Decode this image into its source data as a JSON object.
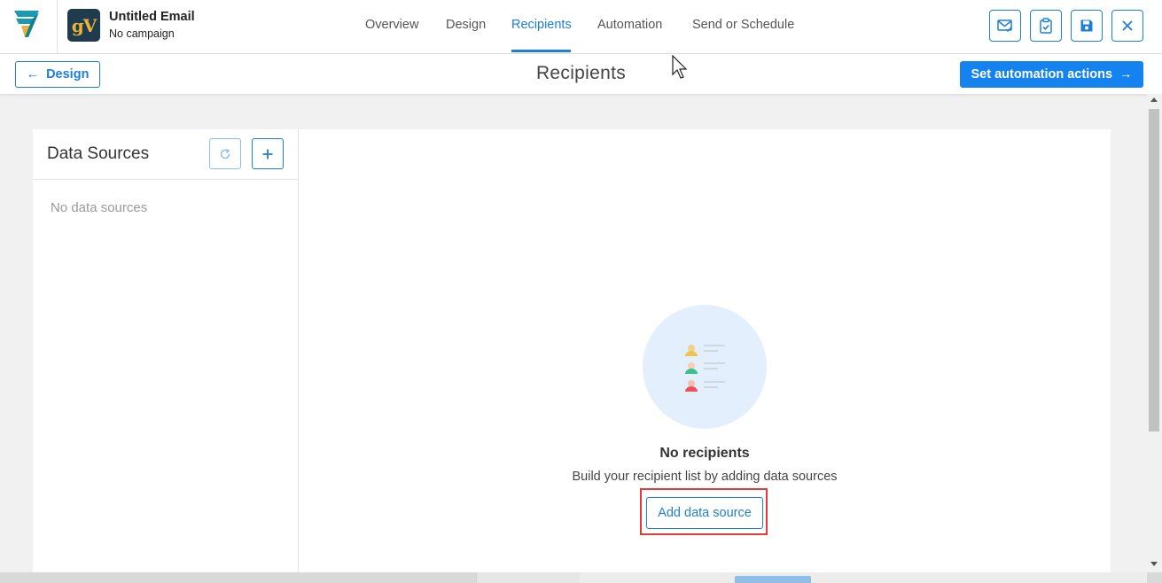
{
  "app": {
    "email_title": "Untitled Email",
    "campaign": "No campaign",
    "avatar_text": "gV"
  },
  "nav": {
    "items": [
      {
        "label": "Overview",
        "active": false
      },
      {
        "label": "Design",
        "active": false
      },
      {
        "label": "Recipients",
        "active": true
      },
      {
        "label": "Automation",
        "active": false
      },
      {
        "label": "Send or Schedule",
        "active": false
      }
    ]
  },
  "toolbar": {
    "icons": [
      "mail-check-icon",
      "clipboard-check-icon",
      "save-icon",
      "close-icon"
    ]
  },
  "subheader": {
    "back_label": "Design",
    "page_title": "Recipients",
    "next_label": "Set automation actions"
  },
  "data_sources": {
    "title": "Data Sources",
    "empty_text": "No data sources"
  },
  "recipients": {
    "empty_title": "No recipients",
    "empty_subtitle": "Build your recipient list by adding data sources",
    "add_label": "Add data source"
  },
  "colors": {
    "accent": "#1e7fd6",
    "primary_button": "#1483f0",
    "highlight": "#e03c3c",
    "empty_circle": "#e3effc"
  }
}
